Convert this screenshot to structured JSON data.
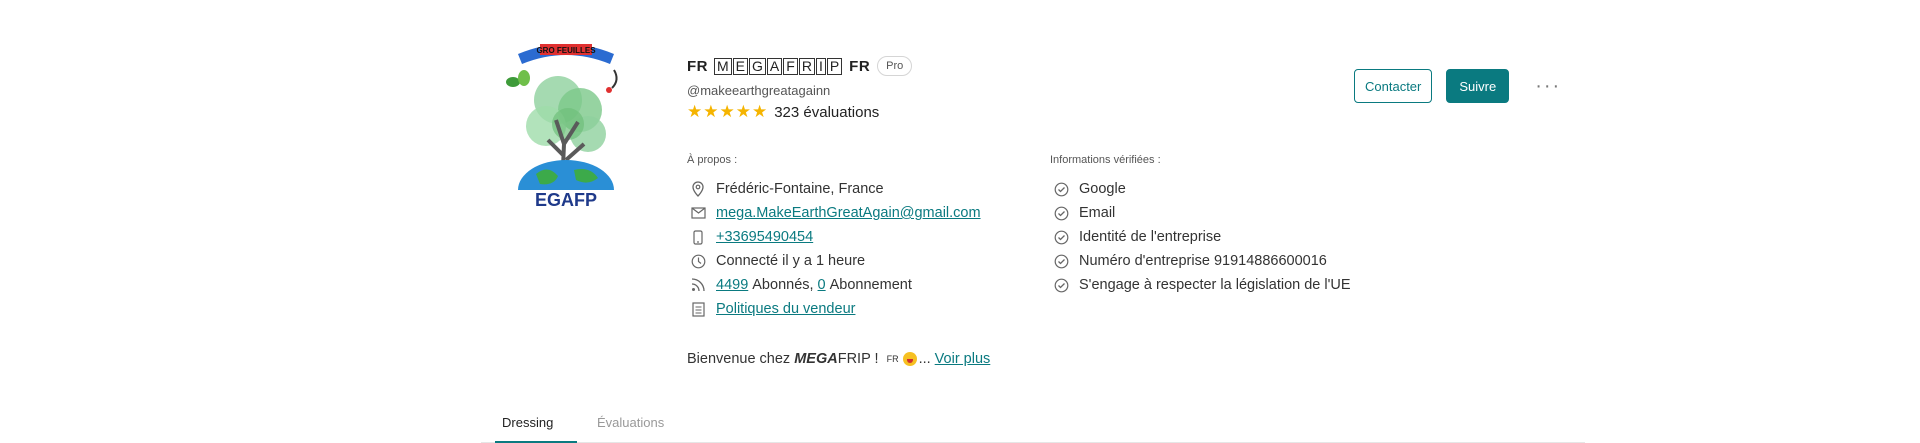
{
  "profile": {
    "flag_left": "FR",
    "name_letters": [
      "M",
      "E",
      "G",
      "A",
      "F",
      "R",
      "I",
      "P"
    ],
    "flag_right": "FR",
    "badge": "Pro",
    "handle": "@makeearthgreatagainn",
    "stars": "★★★★★",
    "rating_count": "323 évaluations",
    "avatar_banner": "GRO FEUILLES",
    "avatar_text": "EGAFP"
  },
  "actions": {
    "contact_label": "Contacter",
    "follow_label": "Suivre",
    "more_label": "···"
  },
  "about": {
    "title": "À propos :",
    "location": "Frédéric-Fontaine, France",
    "email": "mega.MakeEarthGreatAgain@gmail.com",
    "phone": "+33695490454",
    "last_seen": "Connecté il y a 1 heure",
    "followers_count": "4499",
    "followers_label": "Abonnés,",
    "following_count": "0",
    "following_label": "Abonnement",
    "policies": "Politiques du vendeur"
  },
  "verified": {
    "title": "Informations vérifiées :",
    "items": [
      "Google",
      "Email",
      "Identité de l'entreprise",
      "Numéro d'entreprise 91914886600016",
      "S'engage à respecter la législation de l'UE"
    ]
  },
  "bio": {
    "prefix": "Bienvenue chez ",
    "mega": "MEGA",
    "frip": "FRIP ! ",
    "flag": "FR",
    "ellipsis": "...",
    "more_link": "Voir plus"
  },
  "tabs": {
    "dressing": "Dressing",
    "reviews": "Évaluations"
  },
  "colors": {
    "accent": "#0a7a80",
    "stars": "#f5b400"
  }
}
